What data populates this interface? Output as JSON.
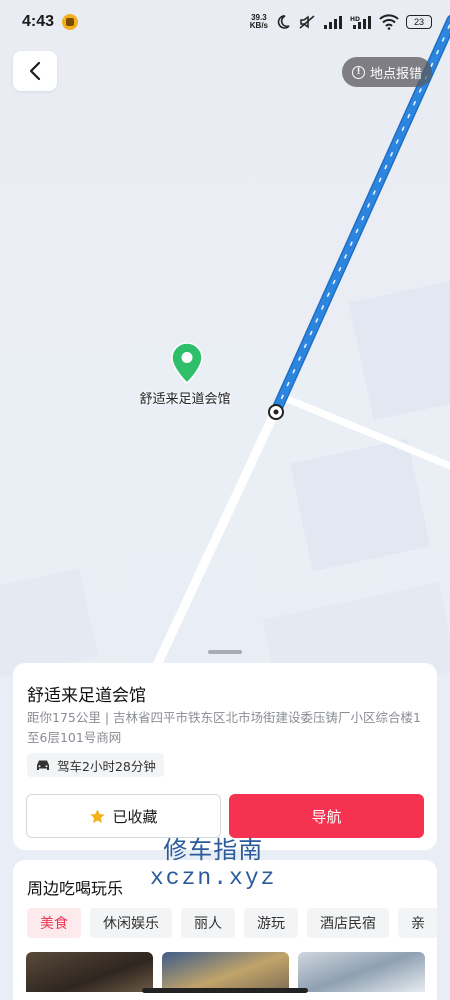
{
  "status_bar": {
    "time": "4:43",
    "net_speed_value": "39.3",
    "net_speed_unit": "KB/s",
    "battery": "23",
    "icons": [
      "notification-icon",
      "moon-icon",
      "mute-icon",
      "signal-icon",
      "hd-icon",
      "wifi-icon",
      "battery-icon"
    ]
  },
  "map": {
    "report_label": "地点报错",
    "poi_name": "舒适来足道会馆",
    "colors": {
      "route": "#2c86e0",
      "marker": "#2fbf6a",
      "road": "#ffffff"
    }
  },
  "info_card": {
    "name": "舒适来足道会馆",
    "address": "距你175公里 | 吉林省四平市铁东区北市场街建设委压铸厂小区综合楼1至6层101号商网",
    "drive_time": "驾车2小时28分钟",
    "favorite_label": "已收藏",
    "navigate_label": "导航",
    "colors": {
      "navigate": "#f5324f",
      "star": "#f2b21c"
    }
  },
  "nearby": {
    "title": "周边吃喝玩乐",
    "categories": [
      "美食",
      "休闲娱乐",
      "丽人",
      "游玩",
      "酒店民宿",
      "亲"
    ],
    "active_category": "美食"
  },
  "watermark": {
    "line1": "修车指南",
    "line2": "xczn.xyz"
  }
}
